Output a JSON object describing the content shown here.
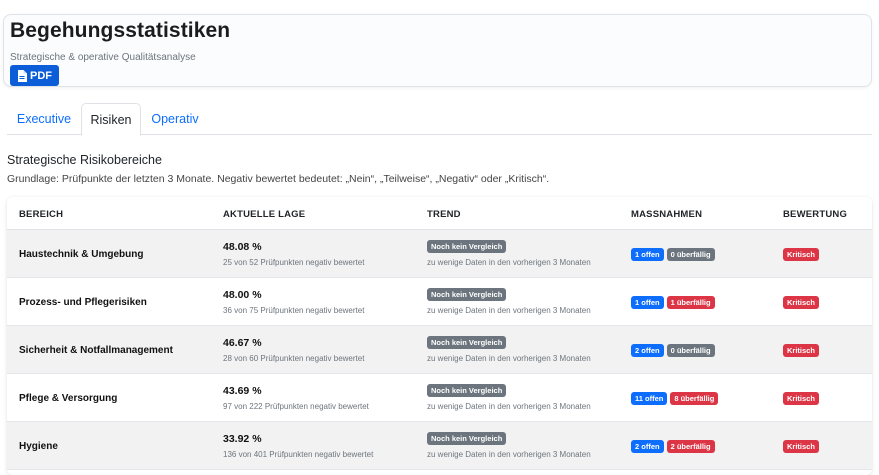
{
  "header": {
    "title": "Begehungsstatistiken",
    "subtitle": "Strategische & operative Qualitätsanalyse",
    "pdf_label": "PDF",
    "pdf_icon": "file-pdf-icon"
  },
  "tabs": [
    {
      "label": "Executive",
      "active": false
    },
    {
      "label": "Risiken",
      "active": true
    },
    {
      "label": "Operativ",
      "active": false
    }
  ],
  "section": {
    "title": "Strategische Risikobereiche",
    "description": "Grundlage: Prüfpunkte der letzten 3 Monate. Negativ bewertet bedeutet: „Nein“, „Teilweise“, „Negativ“ oder „Kritisch“."
  },
  "table": {
    "columns": [
      "BEREICH",
      "AKTUELLE LAGE",
      "TREND",
      "MASSNAHMEN",
      "BEWERTUNG"
    ],
    "rows": [
      {
        "area": "Haustechnik & Umgebung",
        "percent": "48.08 %",
        "detail": "25 von 52 Prüfpunkten negativ bewertet",
        "trend": "Noch kein Vergleich",
        "trend_note": "zu wenige Daten in den vorherigen 3 Monaten",
        "open": "1 offen",
        "overdue": "0 überfällig",
        "overdue_status": "neutral",
        "rating": "Kritisch"
      },
      {
        "area": "Prozess- und Pflegerisiken",
        "percent": "48.00 %",
        "detail": "36 von 75 Prüfpunkten negativ bewertet",
        "trend": "Noch kein Vergleich",
        "trend_note": "zu wenige Daten in den vorherigen 3 Monaten",
        "open": "1 offen",
        "overdue": "1 überfällig",
        "overdue_status": "danger",
        "rating": "Kritisch"
      },
      {
        "area": "Sicherheit & Notfallmanagement",
        "percent": "46.67 %",
        "detail": "28 von 60 Prüfpunkten negativ bewertet",
        "trend": "Noch kein Vergleich",
        "trend_note": "zu wenige Daten in den vorherigen 3 Monaten",
        "open": "2 offen",
        "overdue": "0 überfällig",
        "overdue_status": "neutral",
        "rating": "Kritisch"
      },
      {
        "area": "Pflege & Versorgung",
        "percent": "43.69 %",
        "detail": "97 von 222 Prüfpunkten negativ bewertet",
        "trend": "Noch kein Vergleich",
        "trend_note": "zu wenige Daten in den vorherigen 3 Monaten",
        "open": "11 offen",
        "overdue": "8 überfällig",
        "overdue_status": "danger",
        "rating": "Kritisch"
      },
      {
        "area": "Hygiene",
        "percent": "33.92 %",
        "detail": "136 von 401 Prüfpunkten negativ bewertet",
        "trend": "Noch kein Vergleich",
        "trend_note": "zu wenige Daten in den vorherigen 3 Monaten",
        "open": "2 offen",
        "overdue": "2 überfällig",
        "overdue_status": "danger",
        "rating": "Kritisch"
      }
    ]
  },
  "colors": {
    "primary": "#0d6efd",
    "secondary": "#6c757d",
    "danger": "#dc3545"
  }
}
